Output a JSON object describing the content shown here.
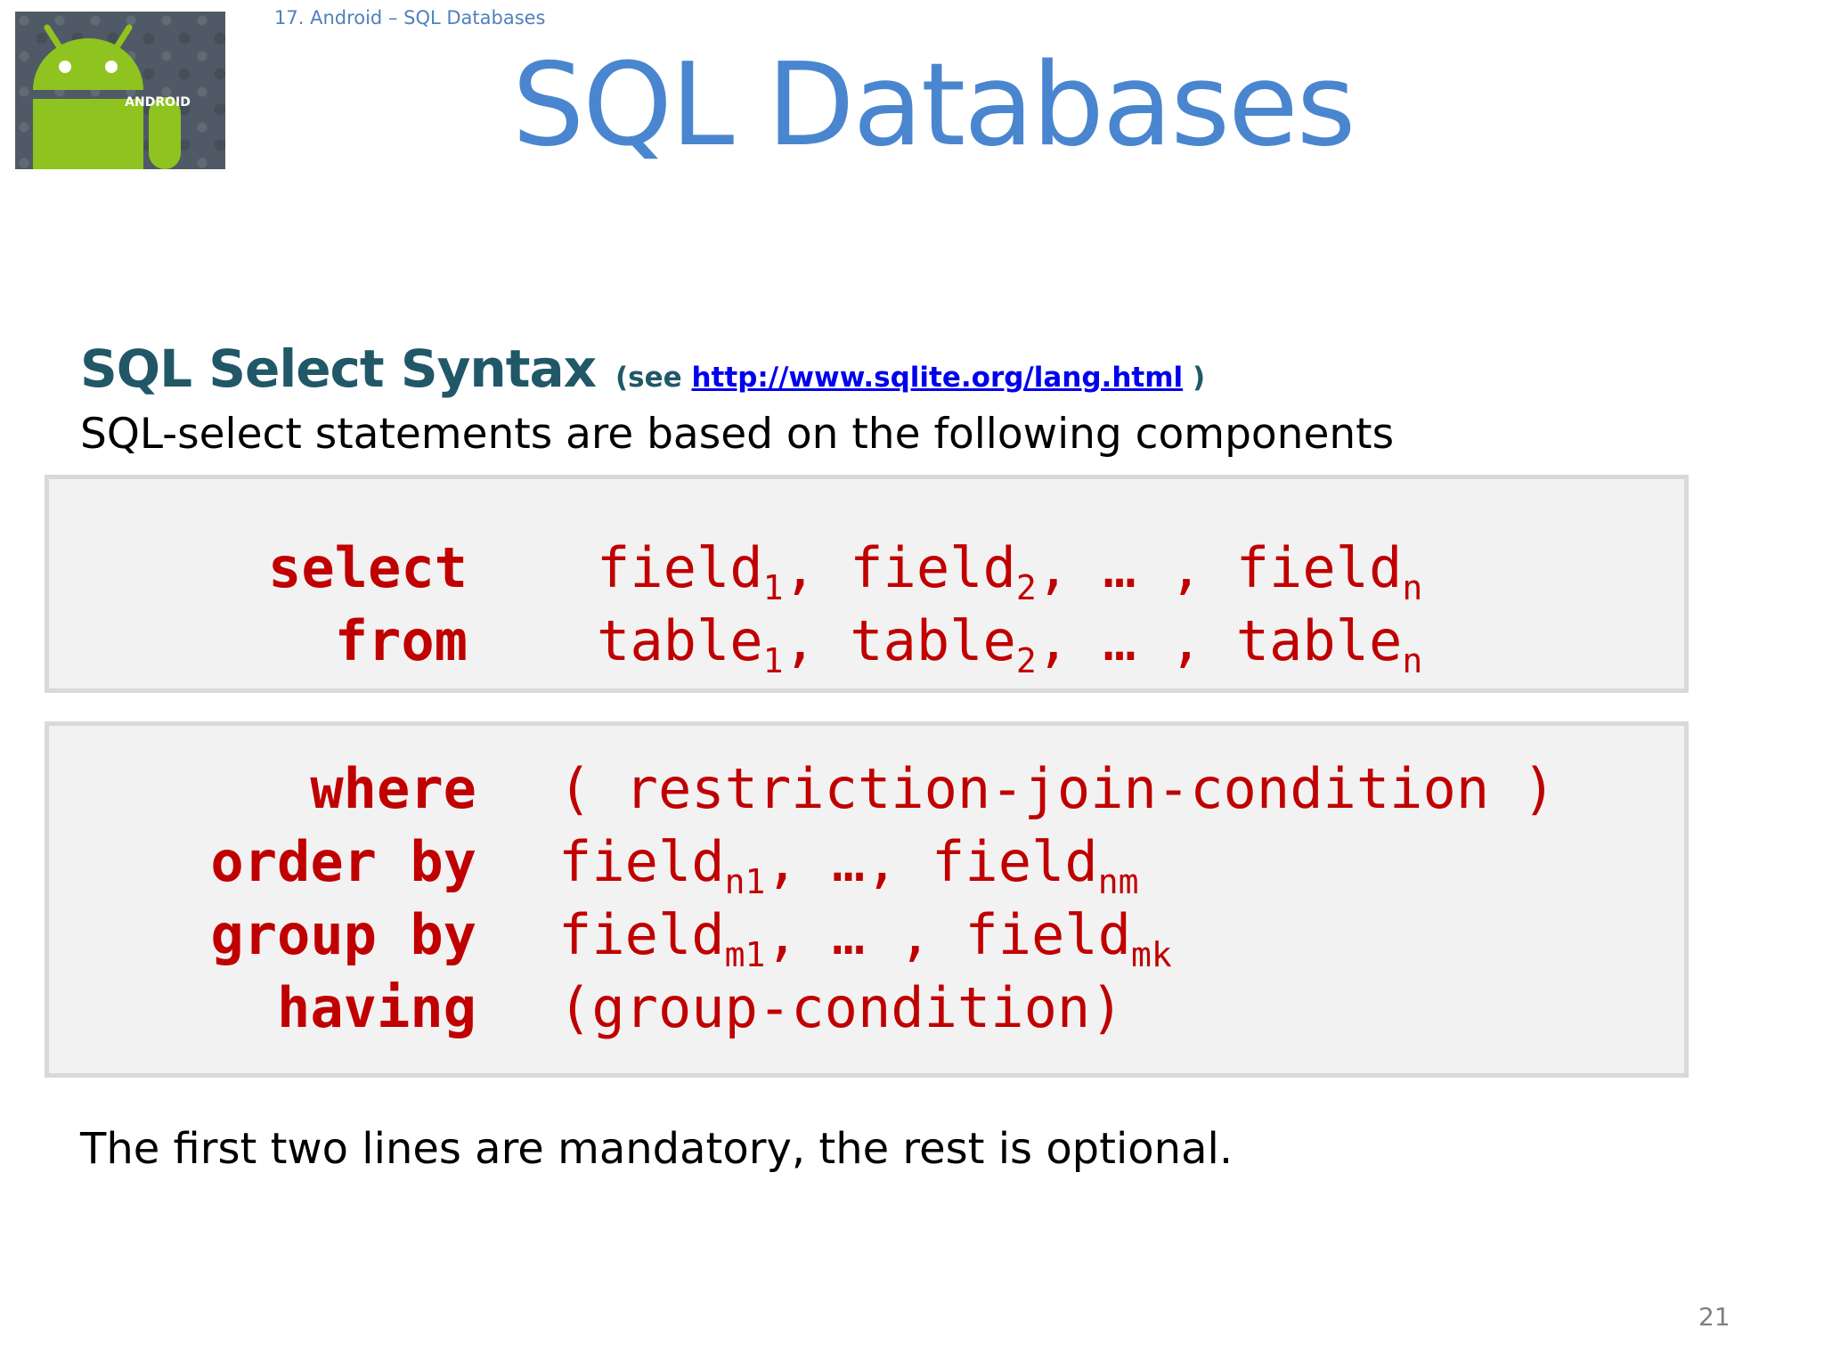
{
  "slide": {
    "breadcrumb": "17. Android – SQL Databases",
    "title": "SQL Databases",
    "page_number": "21"
  },
  "logo": {
    "icon": "android-robot-icon",
    "text": "ANDROID"
  },
  "section": {
    "heading": "SQL Select Syntax",
    "see_prefix": "(see",
    "link_text": "http://www.sqlite.org/lang.html",
    "see_suffix": ")",
    "intro": "SQL-select statements are based on the following components"
  },
  "mandatory_clauses": [
    {
      "keyword": "select",
      "items": [
        {
          "text": "field",
          "sub": "1",
          "after": ", "
        },
        {
          "text": "field",
          "sub": "2",
          "after": ", … , "
        },
        {
          "text": "field",
          "sub": "n",
          "after": ""
        }
      ]
    },
    {
      "keyword": "from",
      "items": [
        {
          "text": "table",
          "sub": "1",
          "after": ", "
        },
        {
          "text": "table",
          "sub": "2",
          "after": ",  … , "
        },
        {
          "text": "table",
          "sub": "n",
          "after": ""
        }
      ]
    }
  ],
  "optional_clauses": [
    {
      "keyword": "where",
      "items": [
        {
          "text": "( restriction-join-condition )",
          "sub": "",
          "after": ""
        }
      ]
    },
    {
      "keyword": "order by",
      "items": [
        {
          "text": "field",
          "sub": "n1",
          "after": ", …, "
        },
        {
          "text": "field",
          "sub": "nm",
          "after": ""
        }
      ]
    },
    {
      "keyword": "group by",
      "items": [
        {
          "text": "field",
          "sub": "m1",
          "after": ", … , "
        },
        {
          "text": "field",
          "sub": "mk",
          "after": ""
        }
      ]
    },
    {
      "keyword": "having",
      "items": [
        {
          "text": "(group-condition)",
          "sub": "",
          "after": ""
        }
      ]
    }
  ],
  "footer_note": "The first two lines are mandatory, the rest is optional.",
  "colors": {
    "title": "#4a86cf",
    "heading": "#215868",
    "code": "#c00000",
    "box_fill": "#f2f2f2",
    "box_border": "#d9d9d9",
    "link": "#0000ee"
  }
}
